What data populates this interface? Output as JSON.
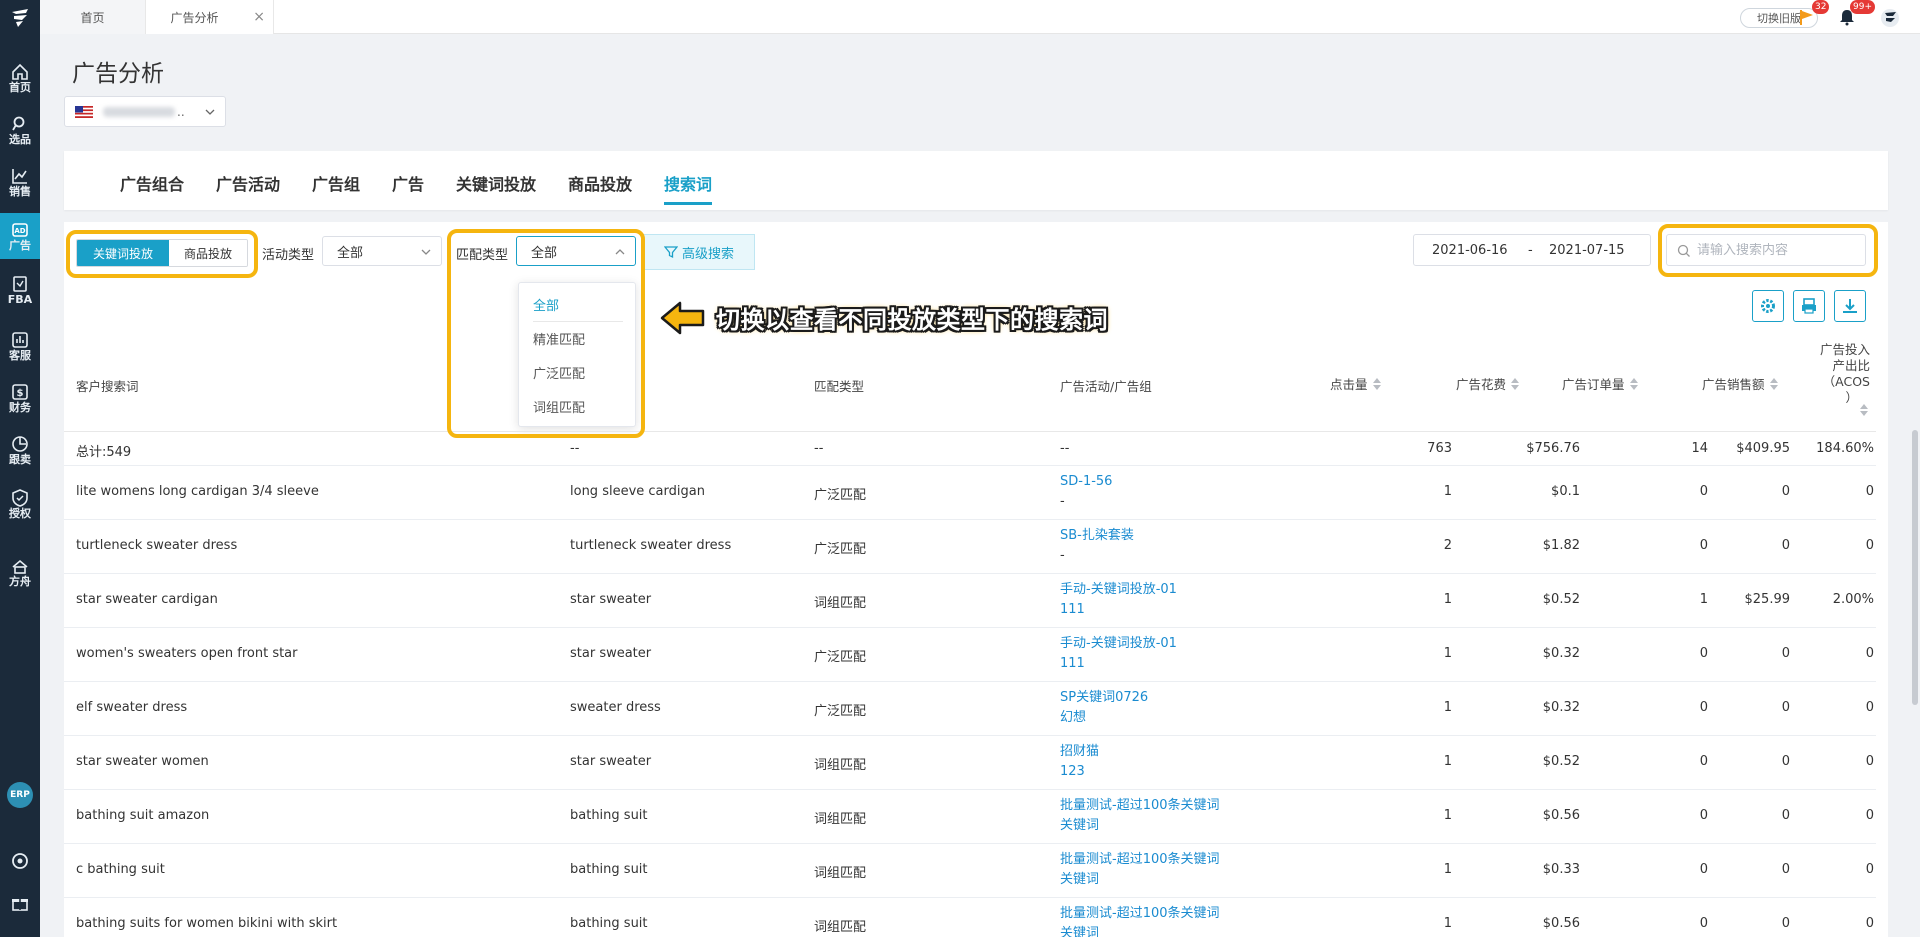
{
  "sidebar": {
    "items": [
      {
        "label": "首页",
        "icon": "home-icon"
      },
      {
        "label": "选品",
        "icon": "search-icon"
      },
      {
        "label": "销售",
        "icon": "chart-icon"
      },
      {
        "label": "广告",
        "icon": "ad-icon"
      },
      {
        "label": "FBA",
        "icon": "fba-icon"
      },
      {
        "label": "客服",
        "icon": "service-icon"
      },
      {
        "label": "财务",
        "icon": "finance-icon"
      },
      {
        "label": "跟卖",
        "icon": "follow-icon"
      },
      {
        "label": "授权",
        "icon": "auth-icon"
      },
      {
        "label": "方舟",
        "icon": "ark-icon"
      }
    ],
    "erp": "ERP"
  },
  "topbar": {
    "tabs": [
      {
        "label": "首页"
      },
      {
        "label": "广告分析"
      }
    ],
    "close": "×",
    "old_version": "切换旧版",
    "flag_badge": "32",
    "bell_badge": "99+"
  },
  "header": {
    "title": "广告分析",
    "store_suffix": ".."
  },
  "main_tabs": [
    "广告组合",
    "广告活动",
    "广告组",
    "广告",
    "关键词投放",
    "商品投放",
    "搜索词"
  ],
  "filters": {
    "seg_active": "关键词投放",
    "seg_other": "商品投放",
    "activity_label": "活动类型",
    "activity_value": "全部",
    "match_label": "匹配类型",
    "match_value": "全部",
    "advanced": "高级搜索",
    "dropdown": [
      "全部",
      "精准匹配",
      "广泛匹配",
      "词组匹配"
    ],
    "date_start": "2021-06-16",
    "date_sep": "-",
    "date_end": "2021-07-15",
    "search_placeholder": "请输入搜索内容"
  },
  "annotation": "切换以查看不同投放类型下的搜索词",
  "accent": "#1aa0c8",
  "highlight": "#f5b50f",
  "table": {
    "headers": {
      "term": "客户搜索词",
      "match": "匹配类型",
      "campaign": "广告活动/广告组",
      "clicks": "点击量",
      "spend": "广告花费",
      "orders": "广告订单量",
      "sales": "广告销售额",
      "acos_1": "广告投入",
      "acos_2": "产出比",
      "acos_3": "（ACOS",
      "acos_4": "）"
    },
    "total": {
      "term": "总计:549",
      "kw": "--",
      "match": "--",
      "campaign": "--",
      "clicks": "763",
      "spend": "$756.76",
      "orders": "14",
      "sales": "$409.95",
      "acos": "184.60%"
    },
    "rows": [
      {
        "term": "lite womens long cardigan 3/4 sleeve",
        "kw": "long sleeve cardigan",
        "match": "广泛匹配",
        "c1": "SD-1-56",
        "c2": "-",
        "clicks": "1",
        "spend": "$0.1",
        "orders": "0",
        "sales": "0",
        "acos": "0"
      },
      {
        "term": "turtleneck sweater dress",
        "kw": "turtleneck sweater dress",
        "match": "广泛匹配",
        "c1": "SB-扎染套装",
        "c2": "-",
        "clicks": "2",
        "spend": "$1.82",
        "orders": "0",
        "sales": "0",
        "acos": "0"
      },
      {
        "term": "star sweater cardigan",
        "kw": "star sweater",
        "match": "词组匹配",
        "c1": "手动-关键词投放-01",
        "c2": "111",
        "clicks": "1",
        "spend": "$0.52",
        "orders": "1",
        "sales": "$25.99",
        "acos": "2.00%"
      },
      {
        "term": "women's sweaters open front star",
        "kw": "star sweater",
        "match": "广泛匹配",
        "c1": "手动-关键词投放-01",
        "c2": "111",
        "clicks": "1",
        "spend": "$0.32",
        "orders": "0",
        "sales": "0",
        "acos": "0"
      },
      {
        "term": "elf sweater dress",
        "kw": "sweater dress",
        "match": "广泛匹配",
        "c1": "SP关键词0726",
        "c2": "幻想",
        "clicks": "1",
        "spend": "$0.32",
        "orders": "0",
        "sales": "0",
        "acos": "0"
      },
      {
        "term": "star sweater women",
        "kw": "star sweater",
        "match": "词组匹配",
        "c1": "招财猫",
        "c2": "123",
        "clicks": "1",
        "spend": "$0.52",
        "orders": "0",
        "sales": "0",
        "acos": "0"
      },
      {
        "term": "bathing suit amazon",
        "kw": "bathing suit",
        "match": "词组匹配",
        "c1": "批量测试-超过100条关键词",
        "c2": "关键词",
        "clicks": "1",
        "spend": "$0.56",
        "orders": "0",
        "sales": "0",
        "acos": "0"
      },
      {
        "term": "c bathing suit",
        "kw": "bathing suit",
        "match": "词组匹配",
        "c1": "批量测试-超过100条关键词",
        "c2": "关键词",
        "clicks": "1",
        "spend": "$0.33",
        "orders": "0",
        "sales": "0",
        "acos": "0"
      },
      {
        "term": "bathing suits for women bikini with skirt",
        "kw": "bathing suit",
        "match": "词组匹配",
        "c1": "批量测试-超过100条关键词",
        "c2": "关键词",
        "clicks": "1",
        "spend": "$0.56",
        "orders": "0",
        "sales": "0",
        "acos": "0"
      }
    ]
  }
}
